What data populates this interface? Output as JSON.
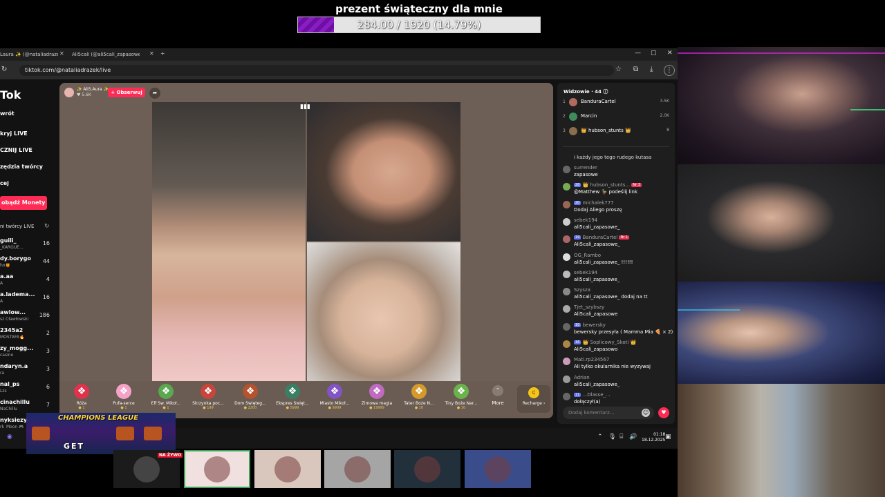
{
  "goal": {
    "title": "prezent świąteczny dla mnie",
    "progress_text": "284.00 / 1920 (14.79%)",
    "progress_fraction": 0.1479
  },
  "browser": {
    "tabs": [
      {
        "label": "Laura ✨ (@nataliadraze..."
      },
      {
        "label": "Ali5cali (@ali5cali_zapasowe_) |"
      }
    ],
    "new_tab_icon": "plus-icon",
    "url": "tiktok.com/@nataliadrazek/live",
    "window_controls": [
      "—",
      "▢",
      "✕"
    ]
  },
  "sidebar": {
    "logo": "Tok",
    "nav": [
      "wrót",
      "kryj LIVE",
      "CZNIJ LIVE",
      "zędzia twórcy",
      "cej"
    ],
    "coins_button": "obądź Monety",
    "creators_heading": "ni twórcy LIVE",
    "creators": [
      {
        "name": "guili_",
        "sub": "_KARGUE...",
        "count": "16"
      },
      {
        "name": "dy.borygo",
        "sub": "ho🍯",
        "count": "44"
      },
      {
        "name": "a.aa",
        "sub": "A",
        "count": "4"
      },
      {
        "name": "a.lademа...",
        "sub": "A",
        "count": "16"
      },
      {
        "name": "awlow...",
        "sub": "sz Cławłowski",
        "count": "186"
      },
      {
        "name": "2345a2",
        "sub": "MOSTAFA🔥",
        "count": "2"
      },
      {
        "name": "zy_mogg...",
        "sub": "casino",
        "count": "3"
      },
      {
        "name": "ndaryn.a",
        "sub": "ra",
        "count": "3"
      },
      {
        "name": "nal_ps",
        "sub": "Lzs",
        "count": "6"
      },
      {
        "name": "cinachillu",
        "sub": "NaChillu",
        "count": "7"
      },
      {
        "name": "nyksiezy...",
        "sub": "rk_Moon 🎮",
        "count": ""
      }
    ]
  },
  "live": {
    "host_name": "✨ Ali5.‍Aura ✨",
    "host_likes": "♥ 5.6K",
    "follow_label": "+ Obserwuj",
    "gifts": [
      {
        "name": "Róża",
        "price": "1",
        "icon": "rose-icon",
        "color": "#e0324b"
      },
      {
        "name": "Pufa-serce",
        "price": "1",
        "icon": "heart-puff-icon",
        "color": "#f4a3c6"
      },
      {
        "name": "Elf Św. Mikoł...",
        "price": "1",
        "icon": "elf-icon",
        "color": "#5aa84f"
      },
      {
        "name": "Skrzynka poc...",
        "price": "199",
        "icon": "mailbox-icon",
        "color": "#c8453b"
      },
      {
        "name": "Dom Święteg...",
        "price": "2200",
        "icon": "santa-house-icon",
        "color": "#b5532f"
      },
      {
        "name": "Ekspres Święt...",
        "price": "5999",
        "icon": "train-icon",
        "color": "#3a7f63"
      },
      {
        "name": "Miasto Mikoł...",
        "price": "9999",
        "icon": "city-icon",
        "color": "#8354c5"
      },
      {
        "name": "Zimowa magia",
        "price": "19999",
        "icon": "winter-magic-icon",
        "color": "#c06ac1"
      },
      {
        "name": "Tater Boże N...",
        "price": "10",
        "icon": "potato-icon",
        "color": "#d59a2a"
      },
      {
        "name": "Tiny Boże Nar...",
        "price": "10",
        "icon": "tiny-tree-icon",
        "color": "#69b34a"
      }
    ],
    "more_label": "More",
    "recharge_label": "Recharge ›"
  },
  "chat": {
    "viewers_label": "Widzowie · 44 ⓘ",
    "viewers": [
      {
        "rank": "1",
        "name": "BanduraCartel",
        "score": "3.5K"
      },
      {
        "rank": "2",
        "name": "Marcin",
        "score": "2.0K"
      },
      {
        "rank": "3",
        "name": "👑 hubson_stunts 👑",
        "score": "8"
      }
    ],
    "partial_line": "i każdy jego tego rudego kutasa",
    "messages": [
      {
        "user": "surrender",
        "badge": "",
        "badge2": "",
        "text": "zapasowe"
      },
      {
        "user": "👑 hubson_stunts...",
        "badge": "28",
        "badge2": "Nr 3",
        "text": "@Matthew 🦆 podeślij link"
      },
      {
        "user": "michalek777",
        "badge": "20",
        "badge2": "",
        "text": "Dodaj Aliego proszę"
      },
      {
        "user": "sebek194",
        "badge": "",
        "badge2": "",
        "text": "ali5cali_zapasowe_"
      },
      {
        "user": "BanduraCartel",
        "badge": "19",
        "badge2": "Nr 1",
        "text": "Ali5cali_zapasowe_"
      },
      {
        "user": "OG_Rambo",
        "badge": "",
        "badge2": "",
        "text": "ali5cali_zapasowe_ !!!!!!"
      },
      {
        "user": "sebek194",
        "badge": "",
        "badge2": "",
        "text": "ali5cali_zapasowe_"
      },
      {
        "user": "Szysza",
        "badge": "",
        "badge2": "",
        "text": "ali5cali_zapasowe_ dodaj na tt"
      },
      {
        "user": "Tjet_szybszy",
        "badge": "",
        "badge2": "",
        "text": "Ali5cali_zapasowe"
      },
      {
        "user": "bewersky",
        "badge": "10",
        "badge2": "",
        "text": "bewersky przesyła ( Mamma Mia 🍕 × 2)"
      },
      {
        "user": "👑 Soplicowy_Skoti 👑",
        "badge": "16",
        "badge2": "",
        "text": "Ali5cali_zapasowo"
      },
      {
        "user": "Mati.rp234567",
        "badge": "",
        "badge2": "",
        "text": "Ali tylko okularnika nie wyzywaj"
      },
      {
        "user": "Adrian",
        "badge": "",
        "badge2": "",
        "text": "ali5cali_zapasowe_"
      },
      {
        "user": "...Dlasse_...",
        "badge": "11",
        "badge2": "",
        "text": "dołączył(a)"
      }
    ],
    "comment_placeholder": "Dodaj komentarz..."
  },
  "overlay": {
    "champions_title": "CHAMPIONS LEAGUE",
    "champions_cta": "GET",
    "live_tag": "NA ŻYWO"
  },
  "taskbar": {
    "time": "01:18",
    "date": "18.12.2025"
  },
  "thumbnails": [
    {
      "icon": "monitor-icon",
      "color": "#1b1b1b"
    },
    {
      "icon": "nfx-avatar-icon",
      "color": "#f0e0e0"
    },
    {
      "icon": "cake-avatar-icon",
      "color": "#d9c7bd"
    },
    {
      "icon": "car-avatar-icon",
      "color": "#a5a5a5"
    },
    {
      "icon": "person-avatar-icon",
      "color": "#22303c"
    },
    {
      "icon": "cartoon-avatar-icon",
      "color": "#3a4d8a"
    }
  ]
}
